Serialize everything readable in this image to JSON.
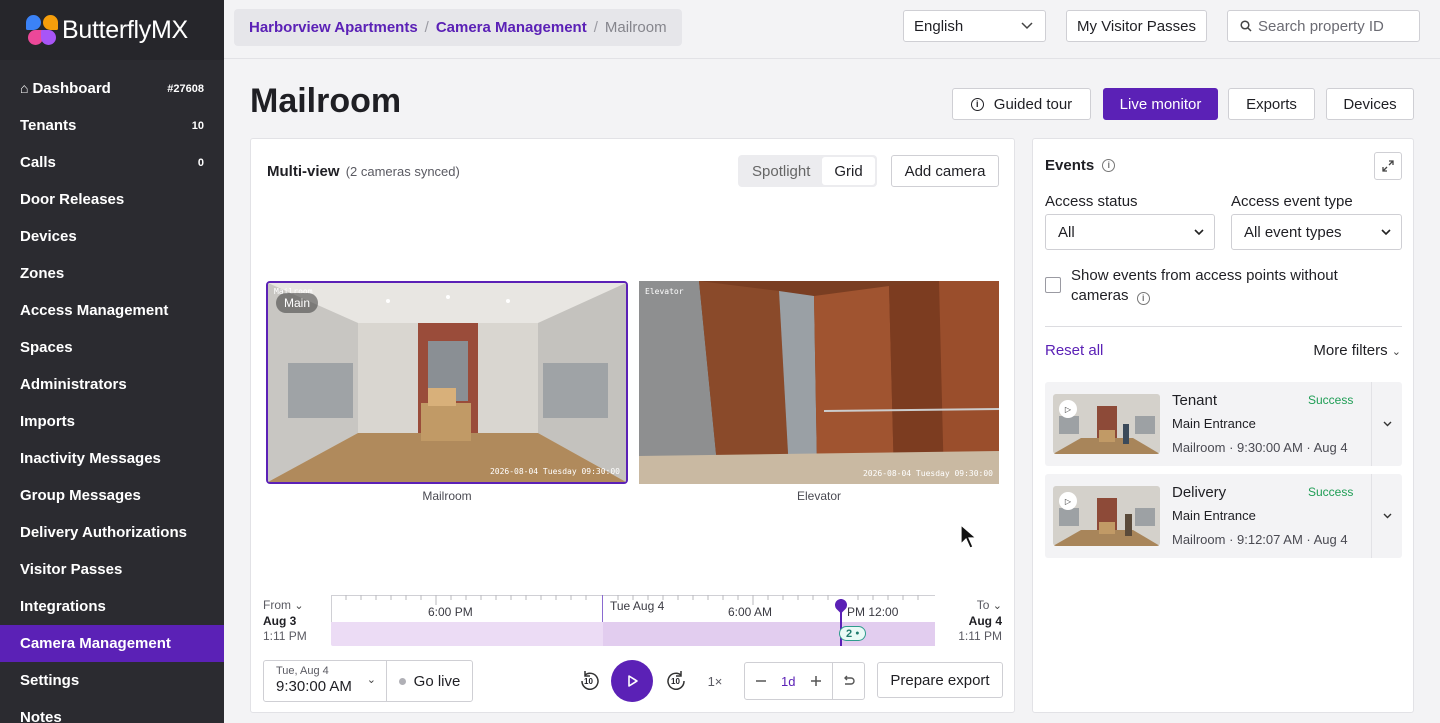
{
  "app": {
    "brand": "ButterflyMX"
  },
  "sidebar": {
    "items": [
      {
        "label": "Dashboard",
        "count": "#27608"
      },
      {
        "label": "Tenants",
        "count": "10"
      },
      {
        "label": "Calls",
        "count": "0"
      },
      {
        "label": "Door Releases",
        "count": ""
      },
      {
        "label": "Devices",
        "count": ""
      },
      {
        "label": "Zones",
        "count": ""
      },
      {
        "label": "Access Management",
        "count": ""
      },
      {
        "label": "Spaces",
        "count": ""
      },
      {
        "label": "Administrators",
        "count": ""
      },
      {
        "label": "Imports",
        "count": ""
      },
      {
        "label": "Inactivity Messages",
        "count": ""
      },
      {
        "label": "Group Messages",
        "count": ""
      },
      {
        "label": "Delivery Authorizations",
        "count": ""
      },
      {
        "label": "Visitor Passes",
        "count": ""
      },
      {
        "label": "Integrations",
        "count": ""
      },
      {
        "label": "Camera Management",
        "count": ""
      },
      {
        "label": "Settings",
        "count": ""
      },
      {
        "label": "Notes",
        "count": ""
      }
    ],
    "active_index": 15,
    "accent": "#5b21b6"
  },
  "topbar": {
    "breadcrumb": [
      "Harborview Apartments",
      "Camera Management",
      "Mailroom"
    ],
    "language": "English",
    "visitor_passes_label": "My Visitor Passes",
    "search_placeholder": "Search property ID"
  },
  "page": {
    "title": "Mailroom",
    "buttons": {
      "guided_tour": "Guided tour",
      "live_monitor": "Live monitor",
      "exports": "Exports",
      "devices": "Devices"
    }
  },
  "multiview": {
    "title": "Multi-view",
    "subtitle": "(2 cameras synced)",
    "view_modes": [
      "Spotlight",
      "Grid"
    ],
    "selected_mode": "Grid",
    "add_camera": "Add camera",
    "cameras": [
      {
        "overlay_name": "Mailroom",
        "badge": "Main",
        "timestamp": "2026-08-04 Tuesday 09:30:00",
        "label": "Mailroom"
      },
      {
        "overlay_name": "Elevator",
        "badge": "",
        "timestamp": "2026-08-04 Tuesday 09:30:00",
        "label": "Elevator"
      }
    ]
  },
  "timeline": {
    "from_label": "From",
    "from_date": "Aug 3",
    "from_time": "1:11 PM",
    "to_label": "To",
    "to_date": "Aug 4",
    "to_time": "1:11 PM",
    "labels": {
      "t1": "6:00 PM",
      "day": "Tue Aug 4",
      "t2": "6:00 AM",
      "t3": "12:00 PM"
    },
    "event_count": "2"
  },
  "controls": {
    "date": "Tue, Aug 4",
    "time": "9:30:00 AM",
    "go_live": "Go live",
    "skip_back": "10",
    "skip_forward": "10",
    "speed": "1×",
    "zoom_value": "1d",
    "prepare_export": "Prepare export"
  },
  "events": {
    "title": "Events",
    "access_status_label": "Access status",
    "access_status_value": "All",
    "event_type_label": "Access event type",
    "event_type_value": "All event types",
    "checkbox_label": "Show events from access points without cameras",
    "reset": "Reset all",
    "more_filters": "More filters",
    "items": [
      {
        "type": "Tenant",
        "status": "Success",
        "location": "Main Entrance",
        "meta": "Mailroom · 9:30:00 AM · Aug 4"
      },
      {
        "type": "Delivery",
        "status": "Success",
        "location": "Main Entrance",
        "meta": "Mailroom · 9:12:07 AM · Aug 4"
      }
    ]
  }
}
